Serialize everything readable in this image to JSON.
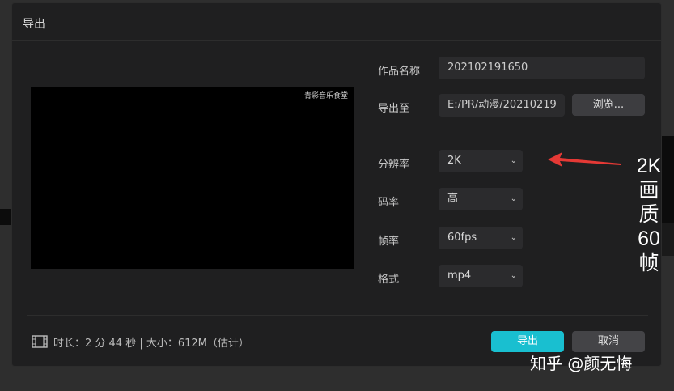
{
  "dialog": {
    "title": "导出",
    "preview_watermark": "青彩音乐食堂"
  },
  "settings": {
    "name_label": "作品名称",
    "name_value": "202102191650",
    "path_label": "导出至",
    "path_value": "E:/PR/动漫/20210219",
    "browse_label": "浏览...",
    "resolution_label": "分辨率",
    "resolution_value": "2K",
    "bitrate_label": "码率",
    "bitrate_value": "高",
    "framerate_label": "帧率",
    "framerate_value": "60fps",
    "format_label": "格式",
    "format_value": "mp4"
  },
  "footer": {
    "info": "时长：2 分 44 秒 | 大小：612M（估计）",
    "export_label": "导出",
    "cancel_label": "取消"
  },
  "annotation": {
    "lines": [
      "2K",
      "画",
      "质",
      "60",
      "帧"
    ],
    "arrow_color": "#e53935"
  },
  "credit": "知乎 @颜无悔",
  "colors": {
    "accent": "#19bfd0",
    "dialog_bg": "#1f1f20",
    "field_bg": "#2b2b2d"
  }
}
